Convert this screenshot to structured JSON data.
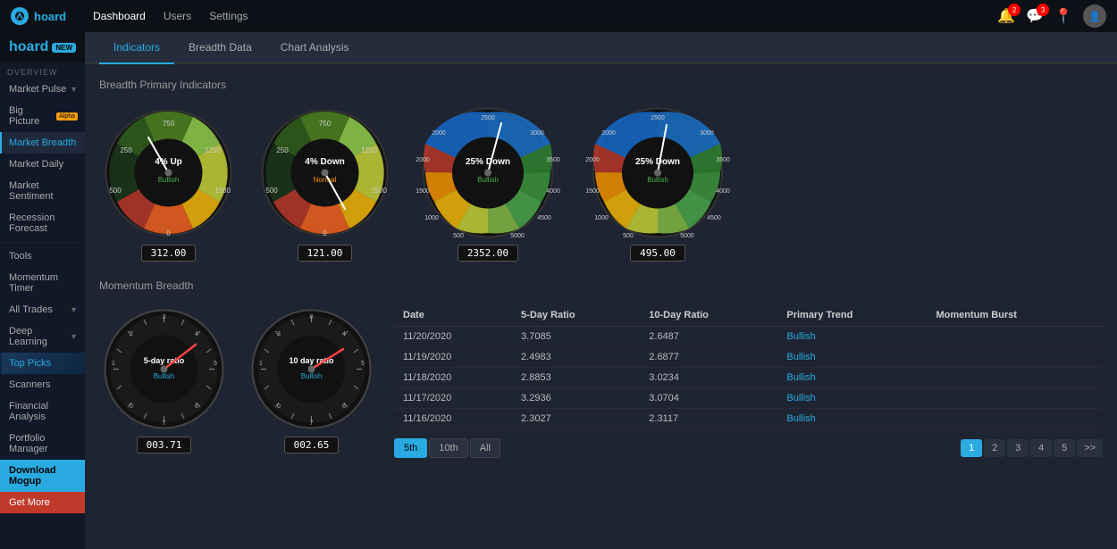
{
  "app": {
    "logo": "hoard",
    "badge": "NEW"
  },
  "topnav": {
    "links": [
      "Dashboard",
      "Users",
      "Settings"
    ]
  },
  "sidebar": {
    "section": "OVERVIEW",
    "items": [
      {
        "label": "Market Pulse",
        "arrow": true
      },
      {
        "label": "Big Picture",
        "badge": "Alpha"
      },
      {
        "label": "Market Breadth"
      },
      {
        "label": "Market Daily"
      },
      {
        "label": "Market Sentiment"
      },
      {
        "label": "Recession Forecast"
      },
      {
        "label": "Tools"
      },
      {
        "label": "Momentum Timer"
      },
      {
        "label": "All Trades",
        "arrow": true
      },
      {
        "label": "Deep Learning",
        "arrow": true
      },
      {
        "label": "Top Picks"
      },
      {
        "label": "Scanners"
      },
      {
        "label": "Financial Analysis"
      },
      {
        "label": "Portfolio Manager"
      },
      {
        "label": "Download Mogup"
      },
      {
        "label": "Get More"
      }
    ]
  },
  "tabs": [
    "Indicators",
    "Breadth Data",
    "Chart Analysis"
  ],
  "active_tab": "Indicators",
  "breadth_section": {
    "title": "Breadth Primary Indicators",
    "gauges": [
      {
        "label": "4% Up",
        "sub": "Bullish",
        "value": "312.00",
        "type": "small"
      },
      {
        "label": "4% Down",
        "sub": "Normal",
        "value": "121.00",
        "type": "small"
      },
      {
        "label": "25% Down",
        "sub": "Bullish",
        "value": "2352.00",
        "type": "large"
      },
      {
        "label": "25% Down",
        "sub": "Bullish",
        "value": "495.00",
        "type": "large"
      }
    ]
  },
  "momentum_section": {
    "title": "Momentum Breadth",
    "gauges": [
      {
        "label": "5-day ratio",
        "sub": "Bullish",
        "value": "003.71"
      },
      {
        "label": "10 day ratio",
        "sub": "Bullish",
        "value": "002.65"
      }
    ],
    "table": {
      "headers": [
        "Date",
        "5-Day Ratio",
        "10-Day Ratio",
        "Primary Trend",
        "Momentum Burst"
      ],
      "rows": [
        {
          "date": "11/20/2020",
          "ratio5": "3.7085",
          "ratio10": "2.6487",
          "trend": "Bullish",
          "burst": ""
        },
        {
          "date": "11/19/2020",
          "ratio5": "2.4983",
          "ratio10": "2.6877",
          "trend": "Bullish",
          "burst": ""
        },
        {
          "date": "11/18/2020",
          "ratio5": "2.8853",
          "ratio10": "3.0234",
          "trend": "Bullish",
          "burst": ""
        },
        {
          "date": "11/17/2020",
          "ratio5": "3.2936",
          "ratio10": "3.0704",
          "trend": "Bullish",
          "burst": ""
        },
        {
          "date": "11/16/2020",
          "ratio5": "2.3027",
          "ratio10": "2.3117",
          "trend": "Bullish",
          "burst": ""
        }
      ]
    },
    "filters": [
      "5th",
      "10th",
      "All"
    ],
    "active_filter": "5th",
    "pages": [
      "1",
      "2",
      "3",
      "4",
      "5",
      ">>"
    ]
  }
}
